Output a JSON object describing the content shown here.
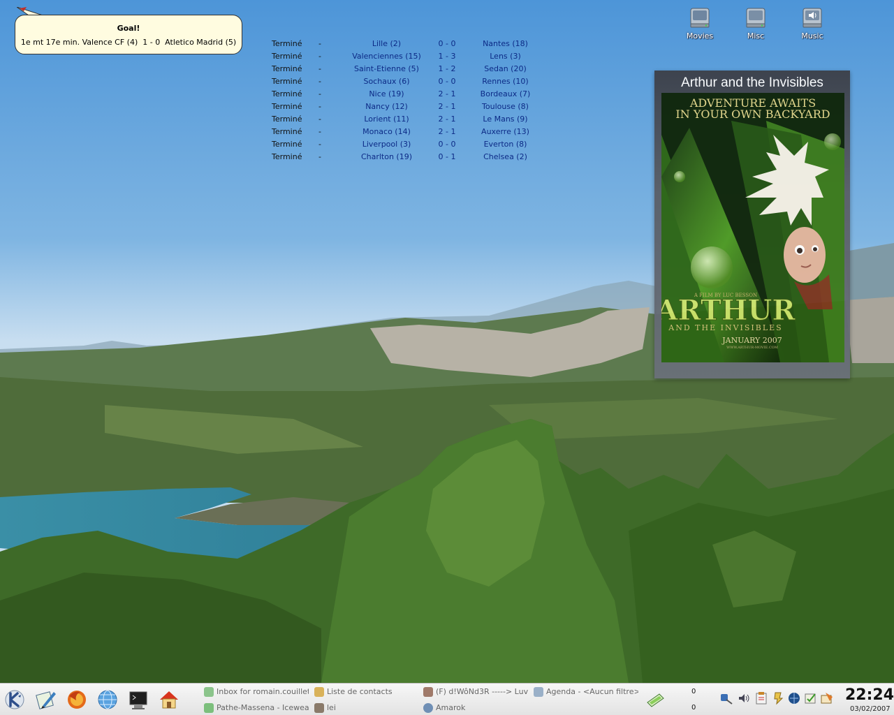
{
  "notification": {
    "title": "Goal!",
    "text": "1e mt 17e min. Valence CF (4)  1 - 0  Atletico Madrid (5)"
  },
  "scores": [
    {
      "status": "Terminé",
      "minute": "-",
      "home": "Lille (2)",
      "score": "0 - 0",
      "away": "Nantes (18)"
    },
    {
      "status": "Terminé",
      "minute": "-",
      "home": "Valenciennes (15)",
      "score": "1 - 3",
      "away": "Lens (3)"
    },
    {
      "status": "Terminé",
      "minute": "-",
      "home": "Saint-Etienne (5)",
      "score": "1 - 2",
      "away": "Sedan (20)"
    },
    {
      "status": "Terminé",
      "minute": "-",
      "home": "Sochaux (6)",
      "score": "0 - 0",
      "away": "Rennes (10)"
    },
    {
      "status": "Terminé",
      "minute": "-",
      "home": "Nice (19)",
      "score": "2 - 1",
      "away": "Bordeaux (7)"
    },
    {
      "status": "Terminé",
      "minute": "-",
      "home": "Nancy (12)",
      "score": "2 - 1",
      "away": "Toulouse (8)"
    },
    {
      "status": "Terminé",
      "minute": "-",
      "home": "Lorient (11)",
      "score": "2 - 1",
      "away": "Le Mans (9)"
    },
    {
      "status": "Terminé",
      "minute": "-",
      "home": "Monaco (14)",
      "score": "2 - 1",
      "away": "Auxerre (13)"
    },
    {
      "status": "Terminé",
      "minute": "-",
      "home": "Liverpool (3)",
      "score": "0 - 0",
      "away": "Everton (8)"
    },
    {
      "status": "Terminé",
      "minute": "-",
      "home": "Charlton (19)",
      "score": "0 - 1",
      "away": "Chelsea (2)"
    }
  ],
  "desktop_icons": [
    {
      "label": "Movies",
      "icon": "drive-icon"
    },
    {
      "label": "Misc",
      "icon": "drive-icon"
    },
    {
      "label": "Music",
      "icon": "speaker-drive-icon"
    }
  ],
  "poster": {
    "title": "Arthur and the Invisibles",
    "tagline_1": "ADVENTURE AWAITS",
    "tagline_2": "IN YOUR OWN BACKYARD",
    "credit": "A FILM BY LUC BESSON",
    "logo": "ARTHUR",
    "subtitle": "AND THE INVISIBLES",
    "release": "JANUARY 2007",
    "url": "WWW.ARTHUR-MOVIE.COM"
  },
  "taskbar": {
    "launchers": [
      "kde-menu-icon",
      "kate-editor-icon",
      "firefox-icon",
      "konqueror-globe-icon",
      "terminal-icon",
      "home-folder-icon"
    ],
    "tasks": [
      {
        "label": "Inbox for romain.couillet",
        "icon": "mail-icon",
        "color": "#8bc48b"
      },
      {
        "label": "Liste de contacts",
        "icon": "contacts-icon",
        "color": "#d9b25a"
      },
      {
        "label": "(F) d!WôNd3R -----> Luv",
        "icon": "chat-avatar-icon",
        "color": "#a07a6a"
      },
      {
        "label": "Agenda - <Aucun filtre>",
        "icon": "agenda-icon",
        "color": "#9ab0c8"
      },
      {
        "label": "Pathe-Massena - Iceweasel",
        "icon": "browser-icon",
        "color": "#7cbf7c"
      },
      {
        "label": "lei",
        "icon": "image-icon",
        "color": "#8a7a6a"
      },
      {
        "label": "Amarok",
        "icon": "amarok-icon",
        "color": "#6f8fb5"
      }
    ],
    "counters": [
      "0",
      "0"
    ],
    "tray": [
      "kmix-icon",
      "volume-icon",
      "clipboard-icon",
      "notes-icon",
      "network-icon",
      "kopete-icon",
      "agenda-tray-icon"
    ],
    "clock_time": "22:24",
    "clock_date": "03/02/2007"
  },
  "colors": {
    "score_text": "#0c2a86",
    "bubble_bg": "#fffce0",
    "taskbar_bg": "#ececec"
  }
}
